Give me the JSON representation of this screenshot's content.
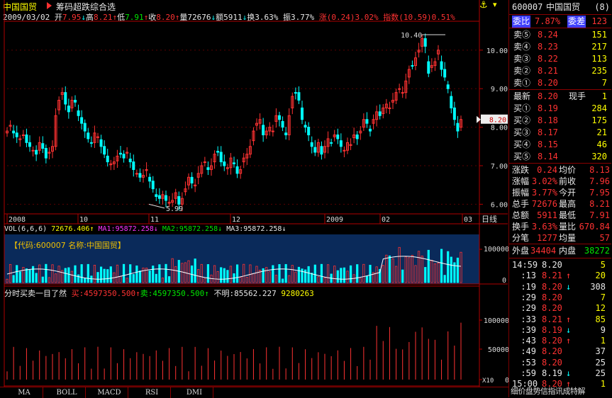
{
  "header": {
    "stock_name": "中国国贸",
    "tool_title": "筹码超跌综合选",
    "date": "2009/03/02",
    "open_label": "开",
    "open_value": "7.95",
    "high_label": "高",
    "high_value": "8.21",
    "low_label": "低",
    "low_value": "7.91",
    "close_label": "收",
    "close_value": "8.20",
    "volume_label": "量",
    "volume_value": "72676",
    "amount_label": "额",
    "amount_value": "5911",
    "turnover_label": "换",
    "turnover_value": "3.63%",
    "amplitude_label": "振",
    "amplitude_value": "3.77%",
    "change_label": "涨",
    "change_value": "(0.24)3.02%",
    "index_label": "指数",
    "index_value": "(10.59)0.51%",
    "anchor_icon": "anchor-icon"
  },
  "price_axis": {
    "ticks": [
      "10.00",
      "9.00",
      "8.00",
      "7.00",
      "6.00"
    ],
    "current_tag": "8.20",
    "max_label": "10.40",
    "min_label": "5.99"
  },
  "time_axis": {
    "labels": [
      "2008",
      "10",
      "11",
      "12",
      "2009",
      "02",
      "03"
    ],
    "period": "日线"
  },
  "volume_panel": {
    "title": "VOL(6,6,6)",
    "vol_value": "72676.406",
    "ma1": "MA1:95872.258",
    "ma2": "MA2:95872.258",
    "ma3": "MA3:95872.258",
    "info": "【代码:600007  名称:中国国贸】",
    "axis_top": "100000",
    "axis_zero": "0"
  },
  "trade_panel": {
    "title": "分时买卖一目了然",
    "buy": "买:4597350.500",
    "sell": "卖:4597350.500",
    "unknown": "不明:85562.227",
    "extra": "9280263",
    "axis_ticks": [
      "100000",
      "50000",
      "0"
    ],
    "multiplier": "X10"
  },
  "right_panel": {
    "code": "600007",
    "name": "中国国贸",
    "suffix": "(8)",
    "weibi_label": "委比",
    "weibi_value": "7.87%",
    "weicha_label": "委差",
    "weicha_value": "123",
    "sells": [
      {
        "label": "卖⑤",
        "price": "8.24",
        "vol": "151"
      },
      {
        "label": "卖④",
        "price": "8.23",
        "vol": "217"
      },
      {
        "label": "卖③",
        "price": "8.22",
        "vol": "113"
      },
      {
        "label": "卖②",
        "price": "8.21",
        "vol": "235"
      },
      {
        "label": "卖①",
        "price": "8.20",
        "vol": "7"
      }
    ],
    "latest_label": "最新",
    "latest_value": "8.20",
    "xianshou_label": "现手",
    "xianshou_value": "1",
    "buys": [
      {
        "label": "买①",
        "price": "8.19",
        "vol": "284"
      },
      {
        "label": "买②",
        "price": "8.18",
        "vol": "175"
      },
      {
        "label": "买③",
        "price": "8.17",
        "vol": "21"
      },
      {
        "label": "买④",
        "price": "8.15",
        "vol": "46"
      },
      {
        "label": "买⑤",
        "price": "8.14",
        "vol": "320"
      }
    ],
    "stats": [
      {
        "l1": "涨跌",
        "v1": "0.24",
        "l2": "均价",
        "v2": "8.13"
      },
      {
        "l1": "涨幅",
        "v1": "3.02%",
        "l2": "前收",
        "v2": "7.96"
      },
      {
        "l1": "振幅",
        "v1": "3.77%",
        "l2": "今开",
        "v2": "7.95"
      },
      {
        "l1": "总手",
        "v1": "72676",
        "l2": "最高",
        "v2": "8.21"
      },
      {
        "l1": "总额",
        "v1": "5911",
        "l2": "最低",
        "v2": "7.91"
      },
      {
        "l1": "换手",
        "v1": "3.63%",
        "l2": "量比",
        "v2": "670.84"
      },
      {
        "l1": "分笔",
        "v1": "1277",
        "l2": "均量",
        "v2": "57"
      }
    ],
    "waipan_label": "外盘",
    "waipan_value": "34404",
    "neipan_label": "内盘",
    "neipan_value": "38272",
    "ticks": [
      {
        "time": "14:59",
        "price": "8.20",
        "dir": "",
        "vol": "5",
        "pc": "w",
        "vc": "y"
      },
      {
        "time": ":13",
        "price": "8.21",
        "dir": "↑",
        "vol": "20",
        "pc": "r",
        "vc": "y"
      },
      {
        "time": ":19",
        "price": "8.20",
        "dir": "↓",
        "vol": "308",
        "pc": "r",
        "vc": "w"
      },
      {
        "time": ":29",
        "price": "8.20",
        "dir": "",
        "vol": "7",
        "pc": "r",
        "vc": "y"
      },
      {
        "time": ":29",
        "price": "8.20",
        "dir": "",
        "vol": "12",
        "pc": "r",
        "vc": "y"
      },
      {
        "time": ":33",
        "price": "8.21",
        "dir": "↑",
        "vol": "85",
        "pc": "r",
        "vc": "y"
      },
      {
        "time": ":39",
        "price": "8.19",
        "dir": "↓",
        "vol": "9",
        "pc": "r",
        "vc": "w"
      },
      {
        "time": ":43",
        "price": "8.20",
        "dir": "↑",
        "vol": "1",
        "pc": "r",
        "vc": "y"
      },
      {
        "time": ":49",
        "price": "8.20",
        "dir": "",
        "vol": "37",
        "pc": "r",
        "vc": "w"
      },
      {
        "time": ":53",
        "price": "8.20",
        "dir": "",
        "vol": "25",
        "pc": "r",
        "vc": "w"
      },
      {
        "time": ":59",
        "price": "8.19",
        "dir": "↓",
        "vol": "25",
        "pc": "w",
        "vc": "w"
      },
      {
        "time": "15:00",
        "price": "8.20",
        "dir": "↑",
        "vol": "1",
        "pc": "r",
        "vc": "y"
      }
    ],
    "footer": "细价盘势信指讯成特解"
  },
  "tabs": [
    "MA",
    "BOLL",
    "MACD",
    "RSI",
    "DMI"
  ],
  "colors": {
    "up": "#ff3232",
    "down": "#00ffff",
    "axis": "#b00000",
    "yellow": "#ffff00",
    "green": "#00e600"
  }
}
